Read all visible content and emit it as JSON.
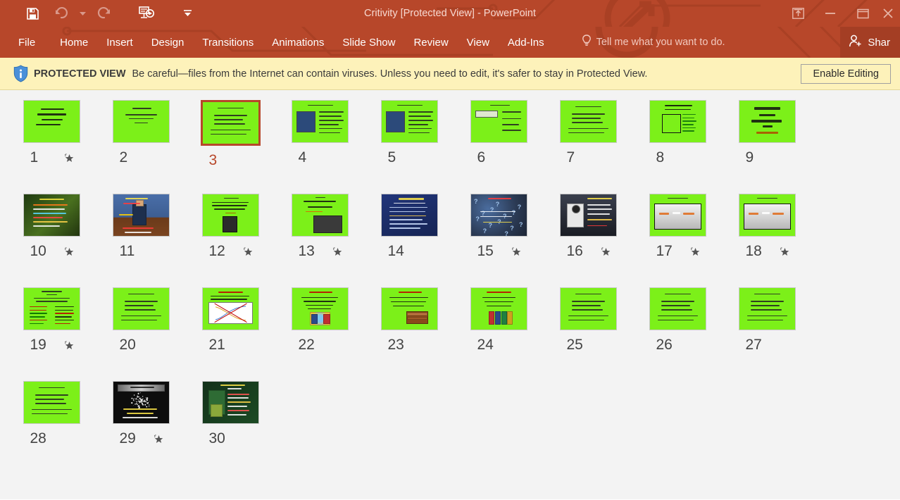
{
  "window": {
    "title": "Critivity [Protected View] - PowerPoint",
    "accent_color": "#b7472a",
    "quick_access": [
      {
        "name": "save",
        "icon": "save-icon",
        "enabled": true
      },
      {
        "name": "undo",
        "icon": "undo-icon",
        "enabled": false
      },
      {
        "name": "undo-dropdown",
        "icon": "chevron-down-icon",
        "enabled": false
      },
      {
        "name": "redo",
        "icon": "redo-icon",
        "enabled": false
      },
      {
        "name": "start-from-beginning",
        "icon": "slideshow-icon",
        "enabled": true
      },
      {
        "name": "customize-quick-access-toolbar",
        "icon": "chevron-down-icon",
        "enabled": true
      }
    ],
    "controls": [
      {
        "name": "ribbon-display-options",
        "icon": "ribbon-options-icon"
      },
      {
        "name": "minimize",
        "icon": "minimize-icon"
      },
      {
        "name": "restore",
        "icon": "restore-icon"
      },
      {
        "name": "close",
        "icon": "close-icon"
      }
    ]
  },
  "ribbon": {
    "tabs": [
      {
        "label": "File"
      },
      {
        "label": "Home"
      },
      {
        "label": "Insert"
      },
      {
        "label": "Design"
      },
      {
        "label": "Transitions"
      },
      {
        "label": "Animations"
      },
      {
        "label": "Slide Show"
      },
      {
        "label": "Review"
      },
      {
        "label": "View"
      },
      {
        "label": "Add-Ins"
      }
    ],
    "tell_me": "Tell me what you want to do.",
    "share": "Shar"
  },
  "protected_view": {
    "label": "PROTECTED VIEW",
    "message": "Be careful—files from the Internet can contain viruses. Unless you need to edit, it's safer to stay in Protected View.",
    "button": "Enable Editing",
    "background": "#fdf2ba"
  },
  "slide_sorter": {
    "selected_slide": 3,
    "slide_count": 30,
    "slides": [
      {
        "number": "1",
        "animated": true,
        "style": "calligraphy",
        "bg": "#7cf019"
      },
      {
        "number": "2",
        "animated": false,
        "style": "text-center",
        "bg": "#7cf019"
      },
      {
        "number": "3",
        "animated": false,
        "style": "bullets",
        "bg": "#7cf019"
      },
      {
        "number": "4",
        "animated": false,
        "style": "image-left",
        "bg": "#7cf019"
      },
      {
        "number": "5",
        "animated": false,
        "style": "image-left",
        "bg": "#7cf019"
      },
      {
        "number": "6",
        "animated": false,
        "style": "box-right",
        "bg": "#7cf019"
      },
      {
        "number": "7",
        "animated": false,
        "style": "bullets",
        "bg": "#7cf019"
      },
      {
        "number": "8",
        "animated": false,
        "style": "flowchart",
        "bg": "#7cf019"
      },
      {
        "number": "9",
        "animated": false,
        "style": "bigtext",
        "bg": "#7cf019"
      },
      {
        "number": "10",
        "animated": true,
        "style": "dark-photo",
        "bg": "#24400f"
      },
      {
        "number": "11",
        "animated": false,
        "style": "photo-person",
        "bg": "#2a3f66"
      },
      {
        "number": "12",
        "animated": true,
        "style": "portrait",
        "bg": "#7cf019"
      },
      {
        "number": "13",
        "animated": true,
        "style": "photo-board",
        "bg": "#7cf019"
      },
      {
        "number": "14",
        "animated": false,
        "style": "dark-blue",
        "bg": "#1b2f6e"
      },
      {
        "number": "15",
        "animated": true,
        "style": "questions",
        "bg": "#2d3c52"
      },
      {
        "number": "16",
        "animated": true,
        "style": "lamp",
        "bg": "#2b2b33"
      },
      {
        "number": "17",
        "animated": true,
        "style": "grey-panel",
        "bg": "#7cf019"
      },
      {
        "number": "18",
        "animated": true,
        "style": "grey-panel",
        "bg": "#7cf019"
      },
      {
        "number": "19",
        "animated": true,
        "style": "two-columns",
        "bg": "#7cf019"
      },
      {
        "number": "20",
        "animated": false,
        "style": "bullets",
        "bg": "#7cf019"
      },
      {
        "number": "21",
        "animated": false,
        "style": "chart-x",
        "bg": "#7cf019"
      },
      {
        "number": "22",
        "animated": false,
        "style": "clipart-ppl",
        "bg": "#7cf019"
      },
      {
        "number": "23",
        "animated": false,
        "style": "clipart-book",
        "bg": "#7cf019"
      },
      {
        "number": "24",
        "animated": false,
        "style": "clipart-grp",
        "bg": "#7cf019"
      },
      {
        "number": "25",
        "animated": false,
        "style": "bullets",
        "bg": "#7cf019"
      },
      {
        "number": "26",
        "animated": false,
        "style": "bullets",
        "bg": "#7cf019"
      },
      {
        "number": "27",
        "animated": false,
        "style": "bullets",
        "bg": "#7cf019"
      },
      {
        "number": "28",
        "animated": false,
        "style": "bullets",
        "bg": "#7cf019"
      },
      {
        "number": "29",
        "animated": true,
        "style": "burst",
        "bg": "#1c1c1c"
      },
      {
        "number": "30",
        "animated": false,
        "style": "dark-green",
        "bg": "#14331a"
      }
    ]
  }
}
